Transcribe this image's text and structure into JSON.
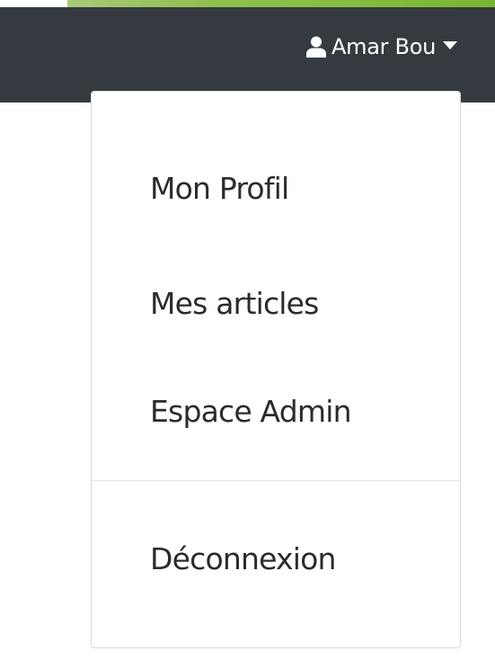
{
  "navbar": {
    "user_icon": "user-icon",
    "user_name": "Amar Bou",
    "caret_icon": "caret-down-icon",
    "background_color": "#343a40"
  },
  "dropdown": {
    "items": [
      {
        "label": "Mon Profil"
      },
      {
        "label": "Mes articles"
      },
      {
        "label": "Espace Admin"
      }
    ],
    "logout_label": "Déconnexion"
  },
  "colors": {
    "banner_green": "#84bd3e",
    "text": "#2b2b2b"
  }
}
